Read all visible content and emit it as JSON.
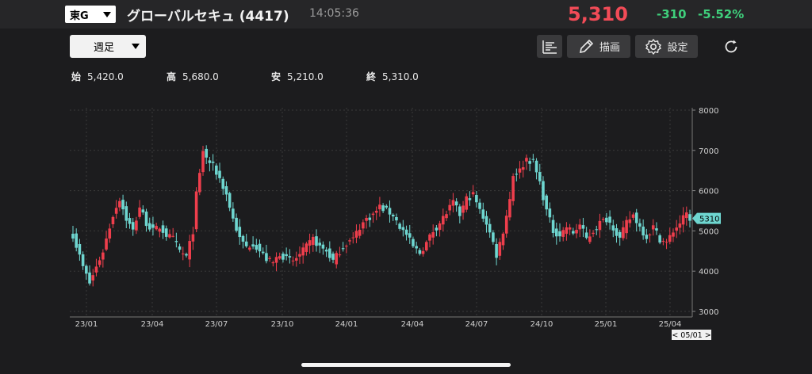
{
  "header": {
    "market": "東G",
    "name": "グローバルセキュ (4417)",
    "time": "14:05:36",
    "price": "5,310",
    "change": "-310",
    "change_pct": "-5.52%"
  },
  "toolbar": {
    "period": "週足",
    "draw_label": "描画",
    "settings_label": "設定",
    "icons": [
      "indicator-list-icon",
      "pencil-icon",
      "gear-icon",
      "refresh-icon"
    ]
  },
  "ohlc": {
    "open_label": "始",
    "open": "5,420.0",
    "high_label": "高",
    "high": "5,680.0",
    "low_label": "安",
    "low": "5,210.0",
    "close_label": "終",
    "close": "5,310.0"
  },
  "colors": {
    "up": "#ef3e4c",
    "down": "#6ed6d0",
    "price": "#f24b57",
    "change": "#3fd07c"
  },
  "chart_data": {
    "type": "candlestick",
    "y_ticks": [
      "8000",
      "7000",
      "6000",
      "5000",
      "4000",
      "3000"
    ],
    "x_ticks": [
      "23/01",
      "23/04",
      "23/07",
      "23/10",
      "24/01",
      "24/04",
      "24/07",
      "24/10",
      "25/01",
      "25/04"
    ],
    "last_price_label": "5310",
    "cursor_label": "< 05/01 >",
    "ylim": [
      2800,
      8200
    ],
    "anchors": [
      [
        0,
        4900
      ],
      [
        3,
        4100
      ],
      [
        5,
        3700
      ],
      [
        7,
        4100
      ],
      [
        9,
        4500
      ],
      [
        12,
        5400
      ],
      [
        14,
        5800
      ],
      [
        16,
        5300
      ],
      [
        18,
        5000
      ],
      [
        20,
        5600
      ],
      [
        22,
        5200
      ],
      [
        24,
        5000
      ],
      [
        26,
        5100
      ],
      [
        28,
        4900
      ],
      [
        30,
        4800
      ],
      [
        32,
        4500
      ],
      [
        34,
        4350
      ],
      [
        36,
        5000
      ],
      [
        37,
        5900
      ],
      [
        38,
        6400
      ],
      [
        39,
        7000
      ],
      [
        40,
        6800
      ],
      [
        42,
        6600
      ],
      [
        44,
        6300
      ],
      [
        46,
        5900
      ],
      [
        48,
        5300
      ],
      [
        50,
        4800
      ],
      [
        52,
        4600
      ],
      [
        54,
        4700
      ],
      [
        56,
        4500
      ],
      [
        58,
        4300
      ],
      [
        60,
        4200
      ],
      [
        62,
        4450
      ],
      [
        64,
        4300
      ],
      [
        66,
        4250
      ],
      [
        68,
        4400
      ],
      [
        70,
        4600
      ],
      [
        72,
        4800
      ],
      [
        74,
        4600
      ],
      [
        76,
        4500
      ],
      [
        78,
        4250
      ],
      [
        80,
        4500
      ],
      [
        82,
        4700
      ],
      [
        84,
        4800
      ],
      [
        86,
        5100
      ],
      [
        88,
        5300
      ],
      [
        90,
        5400
      ],
      [
        92,
        5600
      ],
      [
        94,
        5500
      ],
      [
        96,
        5400
      ],
      [
        98,
        5100
      ],
      [
        100,
        4900
      ],
      [
        102,
        4600
      ],
      [
        104,
        4450
      ],
      [
        106,
        4700
      ],
      [
        108,
        5000
      ],
      [
        110,
        5200
      ],
      [
        112,
        5450
      ],
      [
        114,
        5700
      ],
      [
        116,
        5400
      ],
      [
        118,
        5800
      ],
      [
        120,
        5900
      ],
      [
        122,
        5500
      ],
      [
        124,
        5200
      ],
      [
        126,
        4700
      ],
      [
        127,
        4400
      ],
      [
        129,
        5000
      ],
      [
        131,
        5800
      ],
      [
        132,
        6400
      ],
      [
        134,
        6500
      ],
      [
        136,
        6800
      ],
      [
        138,
        6700
      ],
      [
        140,
        6200
      ],
      [
        142,
        5500
      ],
      [
        144,
        5000
      ],
      [
        146,
        4900
      ],
      [
        148,
        5100
      ],
      [
        150,
        4950
      ],
      [
        152,
        5150
      ],
      [
        154,
        4800
      ],
      [
        156,
        5000
      ],
      [
        158,
        5200
      ],
      [
        160,
        5300
      ],
      [
        162,
        5100
      ],
      [
        164,
        4800
      ],
      [
        166,
        5200
      ],
      [
        168,
        5400
      ],
      [
        170,
        5100
      ],
      [
        172,
        4850
      ],
      [
        174,
        5100
      ],
      [
        176,
        4800
      ],
      [
        178,
        4700
      ],
      [
        180,
        5000
      ],
      [
        182,
        5200
      ],
      [
        184,
        5420
      ],
      [
        185,
        5310
      ]
    ]
  }
}
